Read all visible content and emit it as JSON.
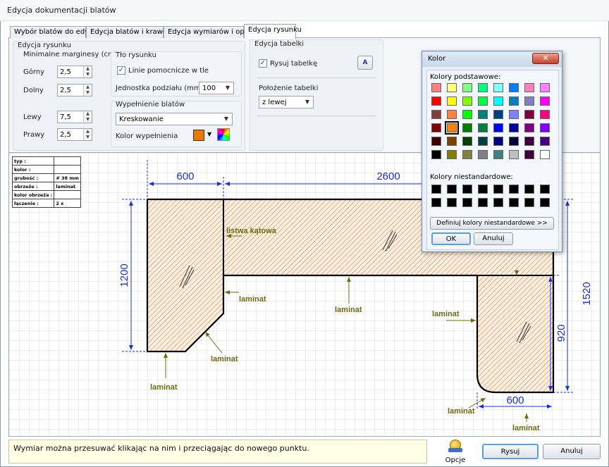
{
  "window": {
    "title": "Edycja dokumentacji blatów"
  },
  "tabs": [
    {
      "label": "Wybór blatów do edycji"
    },
    {
      "label": "Edycja blatów i krawędzi"
    },
    {
      "label": "Edycja wymiarów i opisów"
    },
    {
      "label": "Edycja rysunku"
    }
  ],
  "edit_drawing": {
    "group_title": "Edycja rysunku",
    "margins": {
      "title": "Minimalne marginesy (cm)",
      "top": {
        "label": "Górny",
        "value": "2,5"
      },
      "bottom": {
        "label": "Dolny",
        "value": "2,5"
      },
      "left": {
        "label": "Lewy",
        "value": "7,5"
      },
      "right": {
        "label": "Prawy",
        "value": "2,5"
      }
    },
    "background": {
      "title": "Tło rysunku",
      "helper_lines_label": "Linie pomocnicze w tle",
      "helper_lines_checked": true,
      "unit_label": "Jednostka podziału (mm)",
      "unit_value": "100"
    },
    "fill": {
      "title": "Wypełnienie blatów",
      "pattern_value": "Kreskowanie",
      "color_label": "Kolor wypełnienia",
      "color": "#f07800"
    }
  },
  "edit_table": {
    "title": "Edycja tabelki",
    "draw_table_label": "Rysuj tabelkę",
    "draw_table_checked": true,
    "position_title": "Położenie tabelki",
    "position_value": "z lewej"
  },
  "info_table": [
    {
      "key": "typ :",
      "value": ""
    },
    {
      "key": "kolor :",
      "value": ""
    },
    {
      "key": "grubość :",
      "value": "# 38 mm"
    },
    {
      "key": "obrzeże :",
      "value": "laminat"
    },
    {
      "key": "kolor obrzeża :",
      "value": ""
    },
    {
      "key": "łączenie :",
      "value": "2 x"
    }
  ],
  "drawing": {
    "dims": {
      "d600_top": "600",
      "d2600": "2600",
      "d1200": "1200",
      "d1520": "1520",
      "d920": "920",
      "d600_bottom": "600"
    },
    "labels": {
      "listwa": "listwa kątowa",
      "laminat1": "laminat",
      "laminat2": "laminat",
      "laminat3": "laminat",
      "laminat4": "laminat",
      "laminat5": "laminat",
      "laminat6": "laminat",
      "laminat7": "laminat"
    },
    "fill_color": "#c8782a",
    "dim_color": "#1a2fd8",
    "label_color": "#6b6b10"
  },
  "status": {
    "hint": "Wymiar można przesuwać klikając na nim i przeciągając do nowego punktu."
  },
  "buttons": {
    "options": "Opcje",
    "draw": "Rysuj",
    "cancel": "Anuluj"
  },
  "color_dialog": {
    "title": "Kolor",
    "basic_label": "Kolory podstawowe:",
    "custom_label": "Kolory niestandardowe:",
    "define_button": "Definiuj kolory niestandardowe >>",
    "ok": "OK",
    "cancel": "Anuluj",
    "selected_index": 25,
    "basic_colors": [
      "#ff8080",
      "#ffff80",
      "#80ff80",
      "#00ff80",
      "#80ffff",
      "#0080ff",
      "#ff80c0",
      "#ff80ff",
      "#ff0000",
      "#ffff00",
      "#80ff00",
      "#00ff40",
      "#00ffff",
      "#0080c0",
      "#8080c0",
      "#ff00ff",
      "#804040",
      "#ff8040",
      "#00ff00",
      "#008080",
      "#004080",
      "#8080ff",
      "#800040",
      "#ff0080",
      "#800000",
      "#ff8000",
      "#008000",
      "#008040",
      "#0000ff",
      "#0000a0",
      "#800080",
      "#8000ff",
      "#400000",
      "#804000",
      "#004000",
      "#004040",
      "#000080",
      "#000040",
      "#400040",
      "#400080",
      "#000000",
      "#808000",
      "#808040",
      "#808080",
      "#408080",
      "#c0c0c0",
      "#400040",
      "#ffffff"
    ],
    "custom_colors": [
      "#000000",
      "#000000",
      "#000000",
      "#000000",
      "#000000",
      "#000000",
      "#000000",
      "#000000",
      "#000000",
      "#000000",
      "#000000",
      "#000000",
      "#000000",
      "#000000",
      "#000000",
      "#000000"
    ]
  }
}
